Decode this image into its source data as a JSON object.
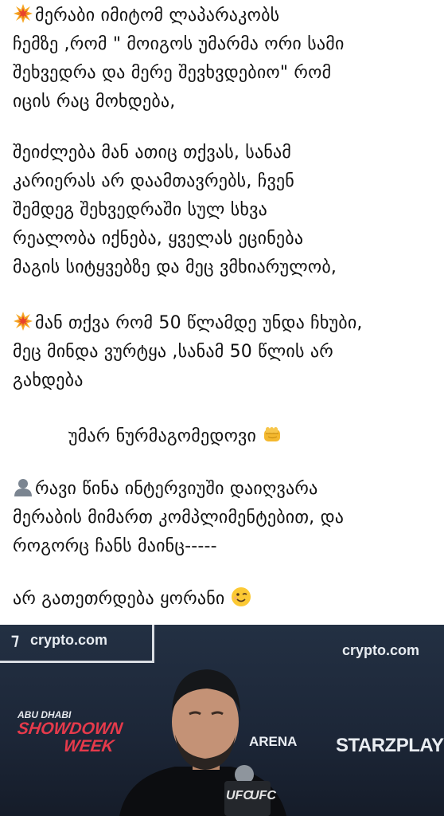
{
  "post": {
    "lines": [
      "მერაბი იმიტომ ლაპარაკობს",
      "ჩემზე ,რომ \" მოიგოს უმარმა ორი სამი",
      "შეხვედრა და მერე შევხვდებიო\" რომ",
      "იცის რაც მოხდება,",
      "შეიძლება მან ათიც თქვას, სანამ",
      "კარიერას არ დაამთავრებს,  ჩვენ",
      "შემდეგ  შეხვედრაში  სულ სხვა",
      "რეალობა იქნება,   ყველას ეცინება",
      "მაგის სიტყვებზე და მეც ვმხიარულობ,",
      "მან თქვა რომ 50 წლამდე უნდა ჩხუბი,",
      "მეც მინდა ვურტყა ,სანამ 50 წლის არ",
      "გახდება",
      "უმარ ნურმაგომედოვი",
      "რავი წინა ინტერვიუში დაიღვარა",
      "მერაბის მიმართ კომპლიმენტებით, და",
      "როგორც ჩანს მაინც-----",
      "არ გათეთრდება ყორანი"
    ],
    "emoji_icons": {
      "collision": "collision-icon",
      "fist": "oncoming-fist-icon",
      "silhouette": "bust-silhouette-icon",
      "wink": "winking-face-icon"
    }
  },
  "photo": {
    "sponsor_left": "crypto.com",
    "sponsor_right": "crypto.com",
    "event_line1": "ABU DHABI",
    "event_line2": "SHOWDOWN",
    "event_line3": "WEEK",
    "arena_text": "ARENA",
    "streaming_brand": "STARZPLAY",
    "mic_flag_left": "UFC",
    "mic_flag_right": "UFC",
    "colors": {
      "background": "#1c2637",
      "event_accent": "#e53a4b"
    }
  }
}
